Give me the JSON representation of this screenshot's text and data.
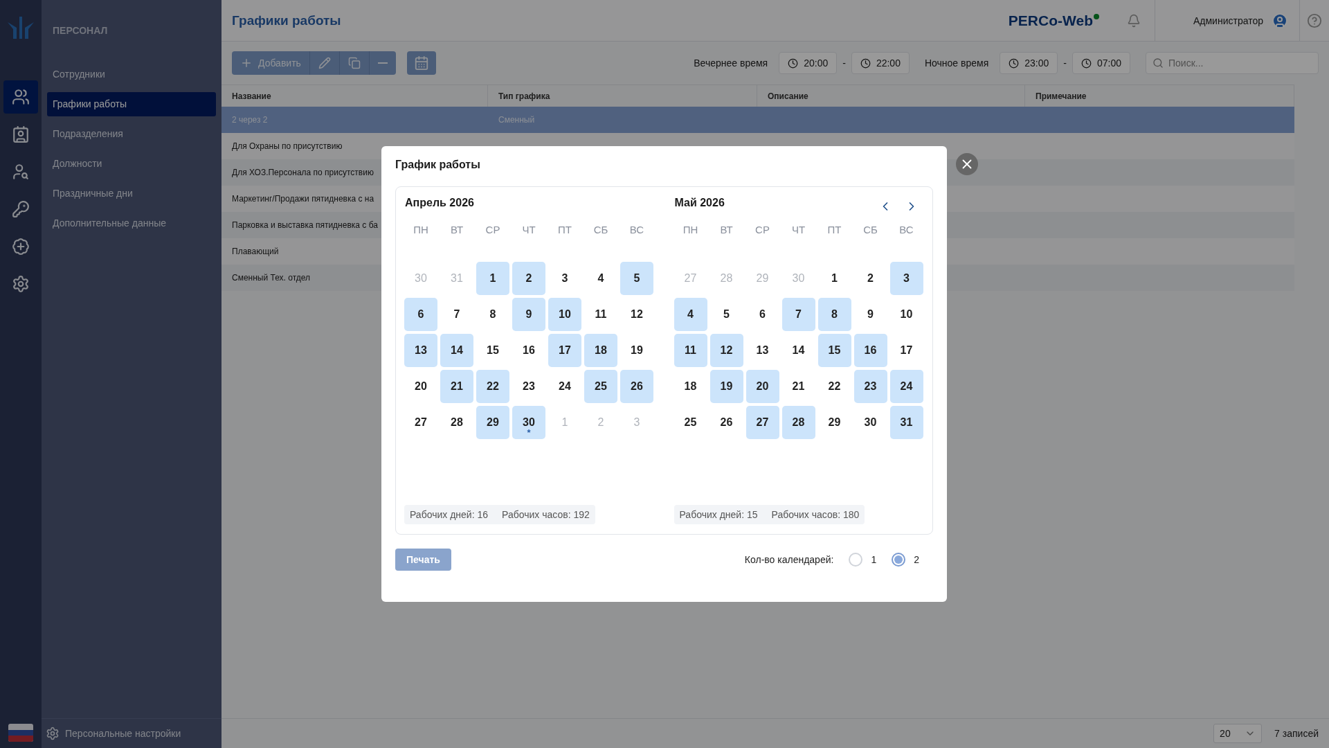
{
  "rail": [
    {
      "selected": true
    },
    {
      "selected": false
    },
    {
      "selected": false
    },
    {
      "selected": false
    },
    {
      "selected": false
    },
    {
      "selected": false
    }
  ],
  "sidebar": {
    "heading": "ПЕРСОНАЛ",
    "items": [
      {
        "label": "Сотрудники",
        "selected": false
      },
      {
        "label": "Графики работы",
        "selected": true
      },
      {
        "label": "Подразделения",
        "selected": false
      },
      {
        "label": "Должности",
        "selected": false
      },
      {
        "label": "Праздничные дни",
        "selected": false
      },
      {
        "label": "Дополнительные данные",
        "selected": false
      }
    ],
    "settings": "Персональные настройки"
  },
  "header": {
    "title": "Графики работы",
    "logo": "PERCo-Web",
    "user": "Администратор"
  },
  "toolbar": {
    "add": "Добавить",
    "evening_label": "Вечернее время",
    "evening_from": "20:00",
    "evening_to": "22:00",
    "night_label": "Ночное время",
    "night_from": "23:00",
    "night_to": "07:00",
    "dash": "-",
    "search_placeholder": "Поиск..."
  },
  "table": {
    "columns": [
      "Название",
      "Тип графика",
      "Описание",
      "Примечание"
    ],
    "rows": [
      {
        "name": "2 через 2",
        "type": "Сменный",
        "selected": true
      },
      {
        "name": "Для Охраны по присутствию",
        "selected": false
      },
      {
        "name": "Для ХОЗ.Персонала по присутствию",
        "selected": false
      },
      {
        "name": "Маркетинг/Продажи пятидневка с на",
        "selected": false
      },
      {
        "name": "Парковка и выставка пятидневка с ба",
        "selected": false
      },
      {
        "name": "Плавающий",
        "selected": false
      },
      {
        "name": "Сменный Тех. отдел",
        "selected": false
      }
    ]
  },
  "footer": {
    "page_size": "20",
    "count": "7 записей"
  },
  "dialog": {
    "title": "График работы",
    "months": [
      {
        "title": "Апрель 2026",
        "weekdays": [
          "ПН",
          "ВТ",
          "СР",
          "ЧТ",
          "ПТ",
          "СБ",
          "ВС"
        ],
        "stats": [
          "Рабочих дней: 16",
          "Рабочих часов: 192"
        ],
        "weeks": [
          [
            {
              "label": "30",
              "outside": true,
              "working": false
            },
            {
              "label": "31",
              "outside": true,
              "working": false
            },
            {
              "label": "1",
              "outside": false,
              "working": true
            },
            {
              "label": "2",
              "outside": false,
              "working": true
            },
            {
              "label": "3",
              "outside": false,
              "working": false
            },
            {
              "label": "4",
              "outside": false,
              "working": false
            },
            {
              "label": "5",
              "outside": false,
              "working": true
            }
          ],
          [
            {
              "label": "6",
              "outside": false,
              "working": true
            },
            {
              "label": "7",
              "outside": false,
              "working": false
            },
            {
              "label": "8",
              "outside": false,
              "working": false
            },
            {
              "label": "9",
              "outside": false,
              "working": true
            },
            {
              "label": "10",
              "outside": false,
              "working": true
            },
            {
              "label": "11",
              "outside": false,
              "working": false
            },
            {
              "label": "12",
              "outside": false,
              "working": false
            }
          ],
          [
            {
              "label": "13",
              "outside": false,
              "working": true
            },
            {
              "label": "14",
              "outside": false,
              "working": true
            },
            {
              "label": "15",
              "outside": false,
              "working": false
            },
            {
              "label": "16",
              "outside": false,
              "working": false
            },
            {
              "label": "17",
              "outside": false,
              "working": true
            },
            {
              "label": "18",
              "outside": false,
              "working": true
            },
            {
              "label": "19",
              "outside": false,
              "working": false
            }
          ],
          [
            {
              "label": "20",
              "outside": false,
              "working": false
            },
            {
              "label": "21",
              "outside": false,
              "working": true
            },
            {
              "label": "22",
              "outside": false,
              "working": true
            },
            {
              "label": "23",
              "outside": false,
              "working": false
            },
            {
              "label": "24",
              "outside": false,
              "working": false
            },
            {
              "label": "25",
              "outside": false,
              "working": true
            },
            {
              "label": "26",
              "outside": false,
              "working": true
            }
          ],
          [
            {
              "label": "27",
              "outside": false,
              "working": false
            },
            {
              "label": "28",
              "outside": false,
              "working": false
            },
            {
              "label": "29",
              "outside": false,
              "working": true
            },
            {
              "label": "30",
              "outside": false,
              "working": true,
              "note": "*"
            },
            {
              "label": "1",
              "outside": true,
              "working": false
            },
            {
              "label": "2",
              "outside": true,
              "working": false
            },
            {
              "label": "3",
              "outside": true,
              "working": false
            }
          ]
        ]
      },
      {
        "title": "Май 2026",
        "weekdays": [
          "ПН",
          "ВТ",
          "СР",
          "ЧТ",
          "ПТ",
          "СБ",
          "ВС"
        ],
        "stats": [
          "Рабочих дней: 15",
          "Рабочих часов: 180"
        ],
        "weeks": [
          [
            {
              "label": "27",
              "outside": true,
              "working": false
            },
            {
              "label": "28",
              "outside": true,
              "working": false
            },
            {
              "label": "29",
              "outside": true,
              "working": false
            },
            {
              "label": "30",
              "outside": true,
              "working": false
            },
            {
              "label": "1",
              "outside": false,
              "working": false
            },
            {
              "label": "2",
              "outside": false,
              "working": false
            },
            {
              "label": "3",
              "outside": false,
              "working": true
            }
          ],
          [
            {
              "label": "4",
              "outside": false,
              "working": true
            },
            {
              "label": "5",
              "outside": false,
              "working": false
            },
            {
              "label": "6",
              "outside": false,
              "working": false
            },
            {
              "label": "7",
              "outside": false,
              "working": true
            },
            {
              "label": "8",
              "outside": false,
              "working": true
            },
            {
              "label": "9",
              "outside": false,
              "working": false
            },
            {
              "label": "10",
              "outside": false,
              "working": false
            }
          ],
          [
            {
              "label": "11",
              "outside": false,
              "working": true
            },
            {
              "label": "12",
              "outside": false,
              "working": true
            },
            {
              "label": "13",
              "outside": false,
              "working": false
            },
            {
              "label": "14",
              "outside": false,
              "working": false
            },
            {
              "label": "15",
              "outside": false,
              "working": true
            },
            {
              "label": "16",
              "outside": false,
              "working": true
            },
            {
              "label": "17",
              "outside": false,
              "working": false
            }
          ],
          [
            {
              "label": "18",
              "outside": false,
              "working": false
            },
            {
              "label": "19",
              "outside": false,
              "working": true
            },
            {
              "label": "20",
              "outside": false,
              "working": true
            },
            {
              "label": "21",
              "outside": false,
              "working": false
            },
            {
              "label": "22",
              "outside": false,
              "working": false
            },
            {
              "label": "23",
              "outside": false,
              "working": true
            },
            {
              "label": "24",
              "outside": false,
              "working": true
            }
          ],
          [
            {
              "label": "25",
              "outside": false,
              "working": false
            },
            {
              "label": "26",
              "outside": false,
              "working": false
            },
            {
              "label": "27",
              "outside": false,
              "working": true
            },
            {
              "label": "28",
              "outside": false,
              "working": true
            },
            {
              "label": "29",
              "outside": false,
              "working": false
            },
            {
              "label": "30",
              "outside": false,
              "working": false
            },
            {
              "label": "31",
              "outside": false,
              "working": true
            }
          ]
        ]
      }
    ],
    "print": "Печать",
    "count_label": "Кол-во календарей:",
    "count_options": [
      {
        "label": "1",
        "selected": false
      },
      {
        "label": "2",
        "selected": true
      }
    ]
  }
}
